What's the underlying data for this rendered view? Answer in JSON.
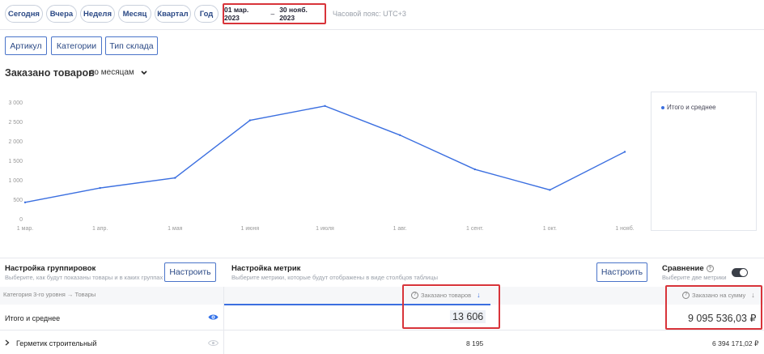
{
  "periods": [
    "Сегодня",
    "Вчера",
    "Неделя",
    "Месяц",
    "Квартал",
    "Год"
  ],
  "date_range": {
    "from": "01 мар. 2023",
    "separator": "–",
    "to": "30 нояб. 2023"
  },
  "timezone": "Часовой пояс: UTC+3",
  "filters": [
    "Артикул",
    "Категории",
    "Тип склада"
  ],
  "section": {
    "title": "Заказано товаров",
    "period_select": "по месяцам"
  },
  "chart_data": {
    "type": "line",
    "x": [
      "1 мар.",
      "1 апр.",
      "1 мая",
      "1 июня",
      "1 июля",
      "1 авг.",
      "1 сент.",
      "1 окт.",
      "1 нояб."
    ],
    "series": [
      {
        "name": "Итого и среднее",
        "values": [
          420,
          790,
          1050,
          2530,
          2900,
          2150,
          1270,
          740,
          1720
        ]
      }
    ],
    "yticks": [
      "3 000",
      "2 500",
      "2 000",
      "1 500",
      "1 000",
      "500",
      "0"
    ],
    "ylim": [
      0,
      3000
    ],
    "color": "#3b6fe0",
    "legend": "right"
  },
  "grouping": {
    "title": "Настройка группировок",
    "desc": "Выберите, как будут показаны товары и в каких группах",
    "button": "Настроить"
  },
  "metrics": {
    "title": "Настройка метрик",
    "desc": "Выберите метрики, которые будут отображены в виде столбцов таблицы",
    "button": "Настроить"
  },
  "comparison": {
    "title": "Сравнение",
    "desc": "Выберите две метрики"
  },
  "table": {
    "group_header": "Категория 3-го уровня → Товары",
    "col1_header": "Заказано товаров",
    "col2_header": "Заказано на сумму",
    "total_label": "Итого и среднее",
    "total_qty": "13 606",
    "total_sum": "9 095 536,03 ₽",
    "row1_label": "Герметик строительный",
    "row1_qty": "8 195",
    "row1_sum": "6 394 171,02 ₽"
  }
}
